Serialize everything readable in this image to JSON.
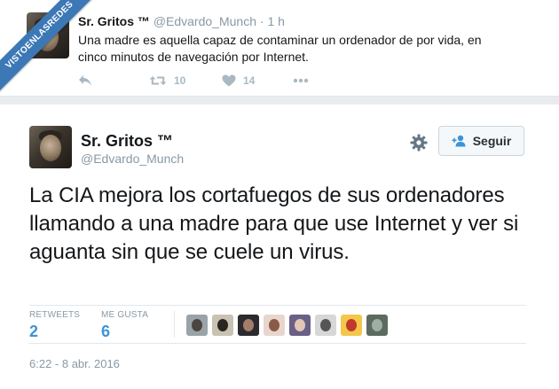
{
  "ribbon": {
    "text": "VISTOENLASREDES"
  },
  "top_tweet": {
    "name": "Sr. Gritos ™",
    "handle": "@Edvardo_Munch",
    "separator": "·",
    "time": "1 h",
    "text": "Una madre es aquella capaz de contaminar un ordenador de por vida, en cinco minutos de navegación por Internet.",
    "retweet_count": "10",
    "like_count": "14",
    "icons": [
      "reply-icon",
      "retweet-icon",
      "heart-icon",
      "more-icon"
    ]
  },
  "main_tweet": {
    "name": "Sr. Gritos ™",
    "handle": "@Edvardo_Munch",
    "follow_label": "Seguir",
    "text": "La CIA mejora los cortafuegos de sus ordenadores llamando a una madre para que use Internet y ver si aguanta sin que se cuele un virus.",
    "stats": {
      "retweets_label": "RETWEETS",
      "retweets": "2",
      "likes_label": "ME GUSTA",
      "likes": "6"
    },
    "timestamp": "6:22 - 8 abr. 2016",
    "liker_avatars": [
      {
        "name": "liker-avatar-1",
        "bg": "#9aa3a8",
        "fg": "#4a4540"
      },
      {
        "name": "liker-avatar-2",
        "bg": "#c9c2b3",
        "fg": "#2a2520"
      },
      {
        "name": "liker-avatar-3",
        "bg": "#2d2a2e",
        "fg": "#a37d6a"
      },
      {
        "name": "liker-avatar-4",
        "bg": "#e8d6cd",
        "fg": "#8a5a48"
      },
      {
        "name": "liker-avatar-5",
        "bg": "#6a5f86",
        "fg": "#e2c7b5"
      },
      {
        "name": "liker-avatar-6",
        "bg": "#d7d7d7",
        "fg": "#555555"
      },
      {
        "name": "liker-avatar-7",
        "bg": "#f2c74a",
        "fg": "#c0392b"
      },
      {
        "name": "liker-avatar-8",
        "bg": "#5b6b60",
        "fg": "#9fb0a0"
      }
    ]
  },
  "colors": {
    "accent": "#3b94d9",
    "muted": "#8899a6",
    "ribbon": "#3c78b6",
    "page_background": "#e9ebee"
  }
}
